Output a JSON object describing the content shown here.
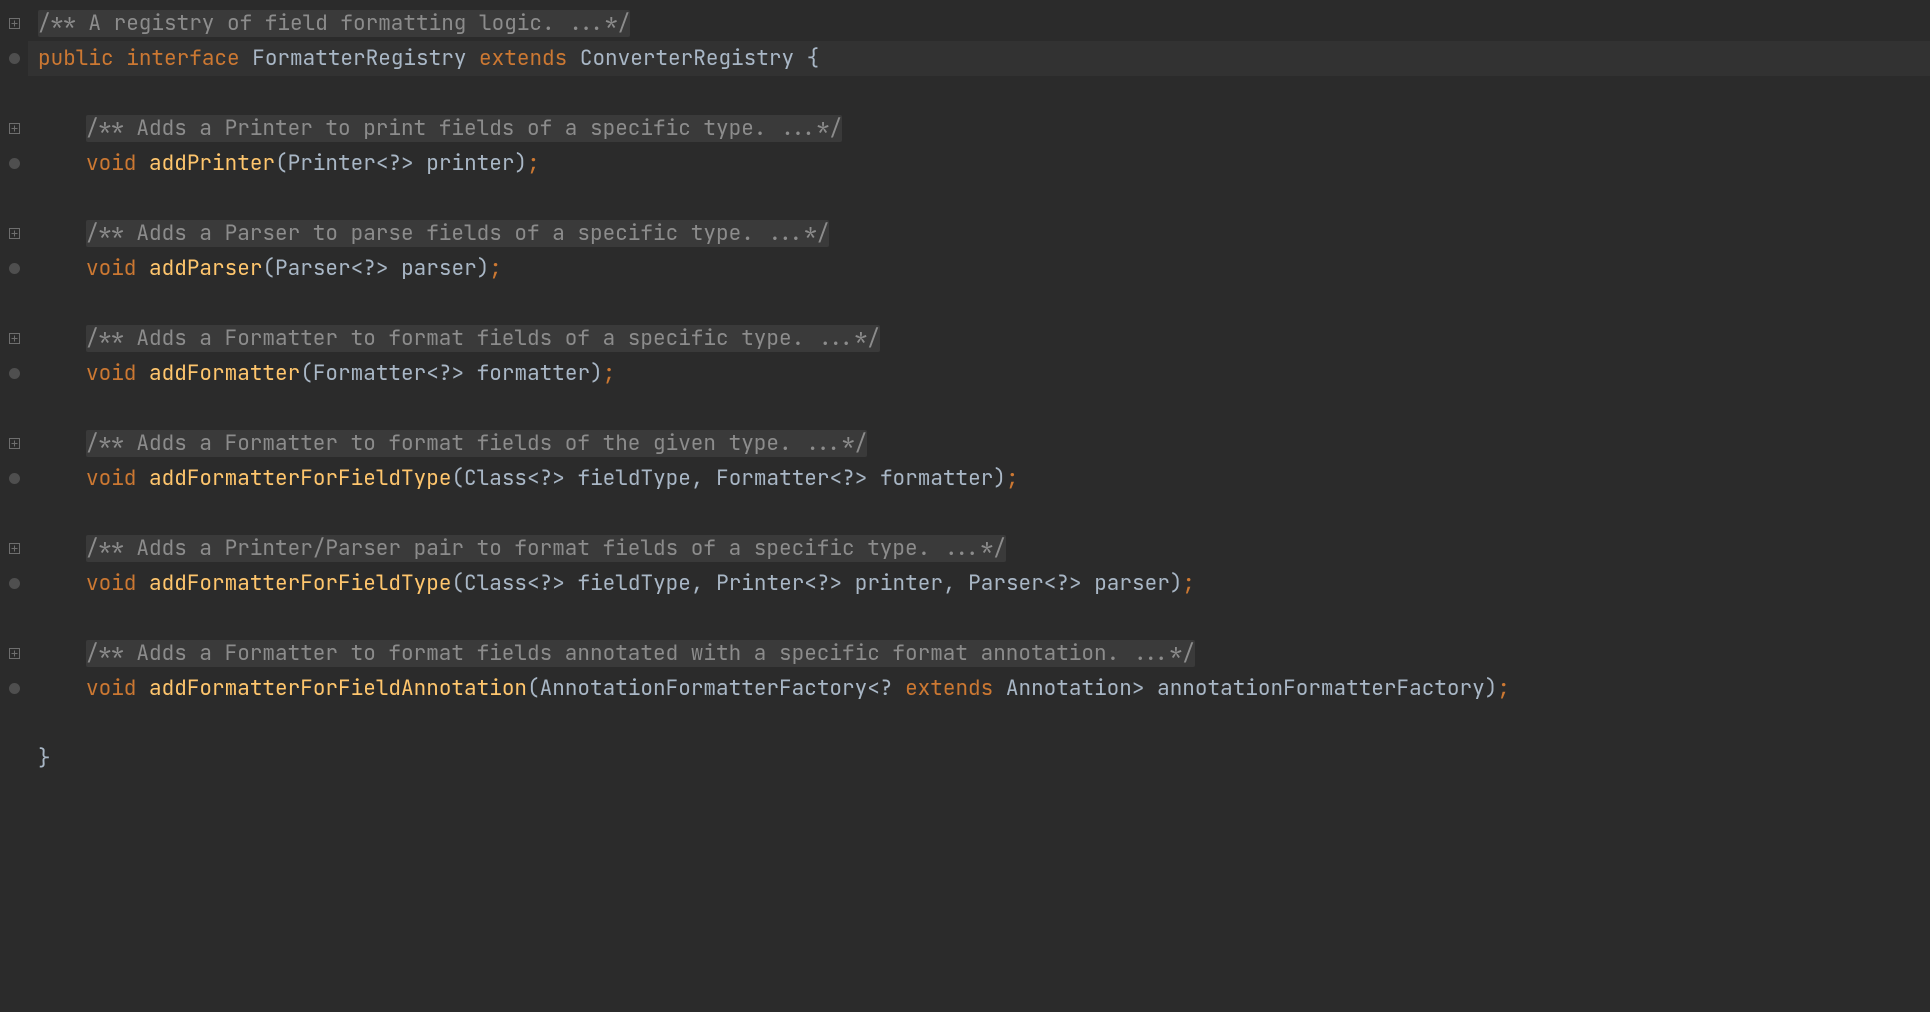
{
  "gutter": {
    "fold_glyph": "plus",
    "impl_glyph": "dot"
  },
  "tokens": {
    "kw_public": "public",
    "kw_interface": "interface",
    "kw_extends": "extends",
    "kw_void": "void",
    "interface_name": "FormatterRegistry",
    "super_interface": "ConverterRegistry",
    "brace_open": "{",
    "brace_close": "}",
    "lt": "<",
    "gt": ">",
    "q": "?",
    "lp": "(",
    "rp": ")",
    "semi": ";",
    "comma": ",",
    "sp": " "
  },
  "comments": {
    "c0": "/** A registry of field formatting logic. ...*/",
    "c1": "/** Adds a Printer to print fields of a specific type. ...*/",
    "c2": "/** Adds a Parser to parse fields of a specific type. ...*/",
    "c3": "/** Adds a Formatter to format fields of a specific type. ...*/",
    "c4": "/** Adds a Formatter to format fields of the given type. ...*/",
    "c5": "/** Adds a Printer/Parser pair to format fields of a specific type. ...*/",
    "c6": "/** Adds a Formatter to format fields annotated with a specific format annotation. ...*/"
  },
  "methods": {
    "m1": {
      "name": "addPrinter",
      "sig_types": [
        "Printer"
      ],
      "params": [
        "printer"
      ]
    },
    "m2": {
      "name": "addParser",
      "sig_types": [
        "Parser"
      ],
      "params": [
        "parser"
      ]
    },
    "m3": {
      "name": "addFormatter",
      "sig_types": [
        "Formatter"
      ],
      "params": [
        "formatter"
      ]
    },
    "m4": {
      "name": "addFormatterForFieldType",
      "sig_types": [
        "Class",
        "Formatter"
      ],
      "params": [
        "fieldType",
        "formatter"
      ]
    },
    "m5": {
      "name": "addFormatterForFieldType",
      "sig_types": [
        "Class",
        "Printer",
        "Parser"
      ],
      "params": [
        "fieldType",
        "printer",
        "parser"
      ]
    },
    "m6": {
      "name": "addFormatterForFieldAnnotation",
      "sig_types": [
        "AnnotationFormatterFactory"
      ],
      "bounded_type": "Annotation",
      "params": [
        "annotationFormatterFactory"
      ]
    }
  }
}
